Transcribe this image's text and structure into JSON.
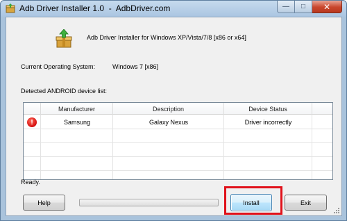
{
  "window": {
    "title": "Adb Driver Installer 1.0  -  AdbDriver.com",
    "caption_buttons": {
      "minimize": "—",
      "maximize": "□",
      "close": "✕"
    }
  },
  "header": {
    "icon": "package-install-icon",
    "text": "Adb Driver Installer for Windows XP/Vista/7/8 [x86 or x64]"
  },
  "os": {
    "label": "Current Operating System:",
    "value": "Windows 7  [x86]"
  },
  "device_list": {
    "label": "Detected ANDROID device list:",
    "columns": [
      "Manufacturer",
      "Description",
      "Device Status"
    ],
    "rows": [
      {
        "icon": "error-icon",
        "icon_glyph": "!",
        "manufacturer": "Samsung",
        "description": "Galaxy Nexus",
        "status": "Driver incorrectly"
      }
    ]
  },
  "status": {
    "text": "Ready."
  },
  "progress": {
    "value": 0
  },
  "buttons": {
    "help": "Help",
    "install": "Install",
    "exit": "Exit"
  },
  "colors": {
    "highlight": "#e0111a",
    "error": "#d50e0e",
    "title_bar": "#aac5e1"
  }
}
